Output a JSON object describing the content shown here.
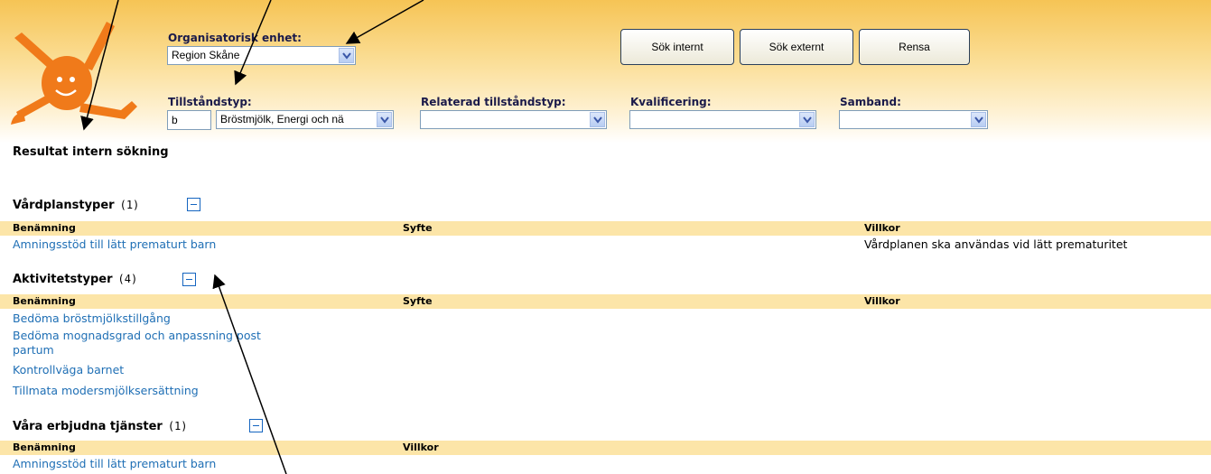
{
  "filters": {
    "org": {
      "label": "Organisatorisk enhet:",
      "value": "Region Skåne"
    },
    "tillstand": {
      "label": "Tillståndstyp:",
      "code": "b",
      "value": "Bröstmjölk, Energi och nä"
    },
    "relaterad": {
      "label": "Relaterad tillståndstyp:",
      "value": ""
    },
    "kvalificering": {
      "label": "Kvalificering:",
      "value": ""
    },
    "samband": {
      "label": "Samband:",
      "value": ""
    }
  },
  "buttons": {
    "search_internal": "Sök internt",
    "search_external": "Sök externt",
    "clear": "Rensa"
  },
  "results": {
    "title": "Resultat intern sökning",
    "vardplan": {
      "title": "Vårdplanstyper",
      "count": "(1)",
      "headers": [
        "Benämning",
        "Syfte",
        "Villkor"
      ],
      "rows": [
        {
          "name": "Amningsstöd till lätt prematurt barn",
          "villkor": "Vårdplanen ska användas vid lätt prematuritet"
        }
      ]
    },
    "aktivitet": {
      "title": "Aktivitetstyper",
      "count": "(4)",
      "headers": [
        "Benämning",
        "Syfte",
        "Villkor"
      ],
      "rows": [
        "Bedöma bröstmjölkstillgång",
        "Bedöma mognadsgrad och anpassning post",
        "partum",
        "Kontrollväga barnet",
        "Tillmata modersmjölksersättning"
      ]
    },
    "tjanster": {
      "title": "Våra erbjudna tjänster",
      "count": "(1)",
      "headers": [
        "Benämning",
        "Villkor"
      ],
      "rows": [
        "Amningsstöd till lätt prematurt barn"
      ]
    }
  }
}
